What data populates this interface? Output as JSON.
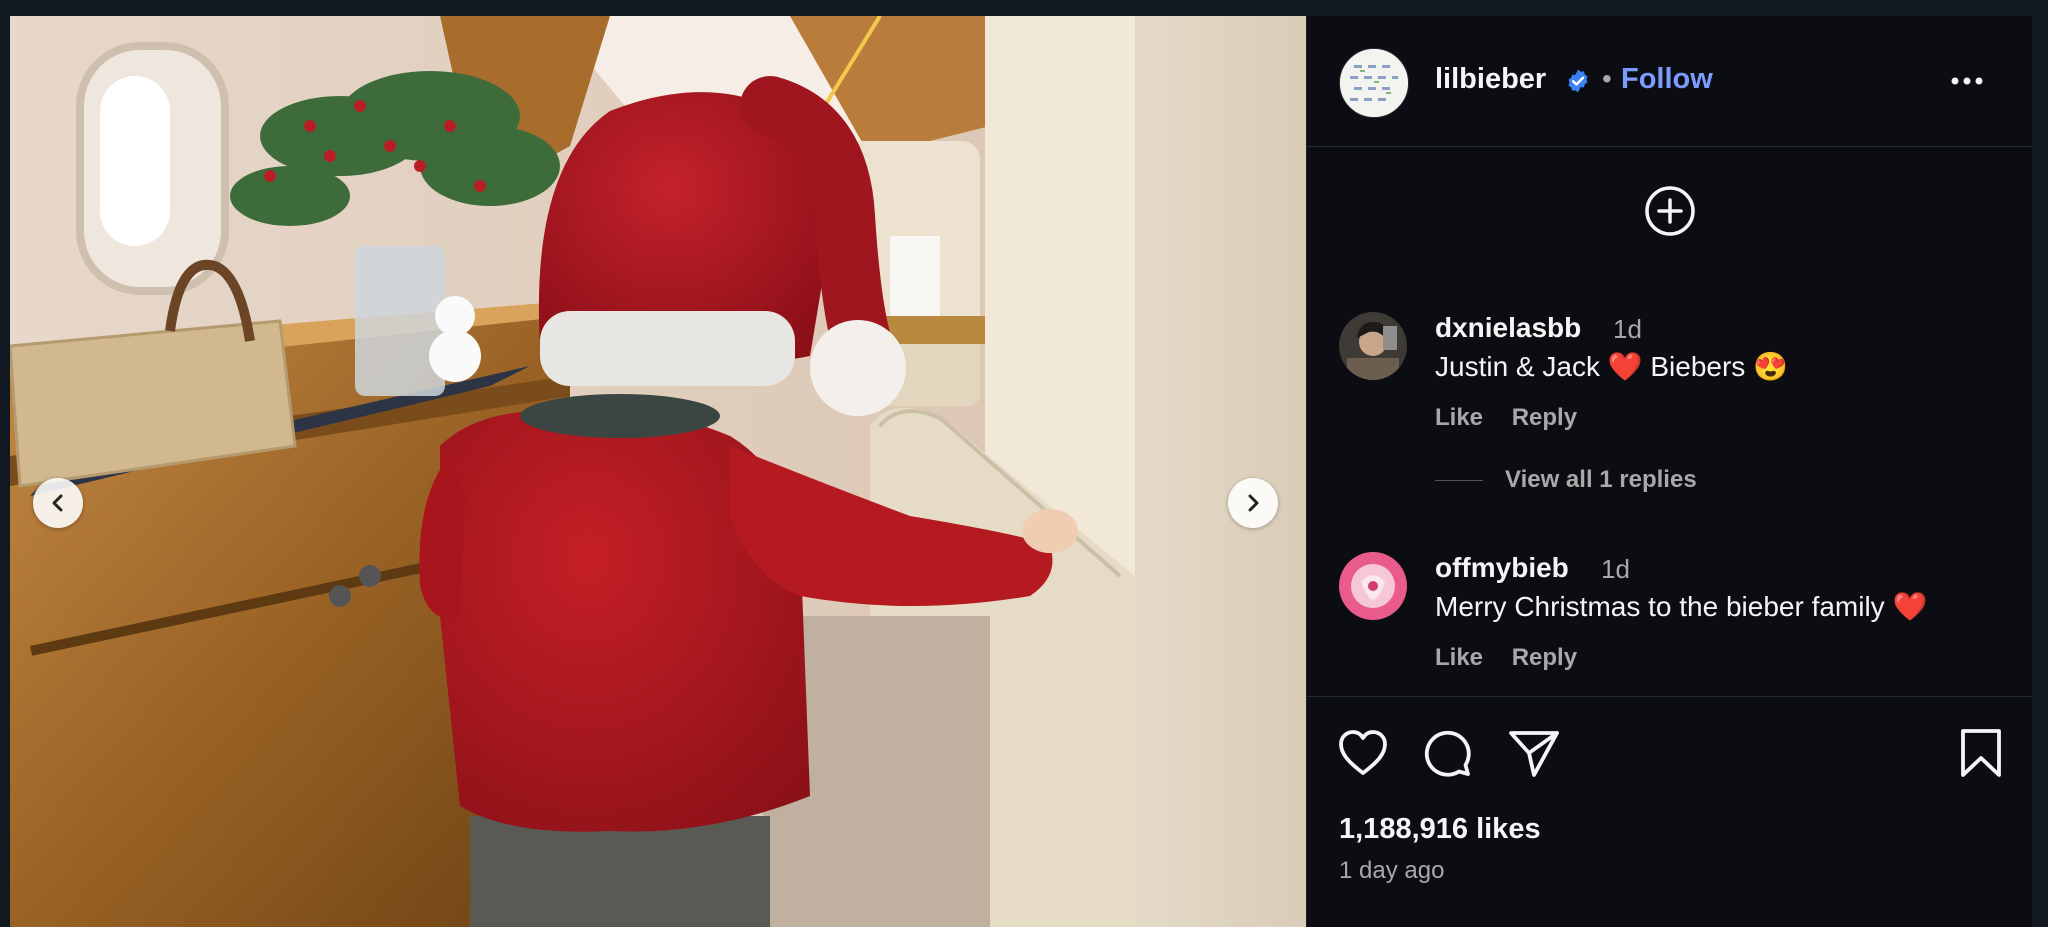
{
  "post": {
    "author": "lilbieber",
    "follow_label": "Follow",
    "separator": "•",
    "likes": "1,188,916 likes",
    "posted": "1 day ago"
  },
  "comments": [
    {
      "user": "dxnielasbb",
      "time": "1d",
      "text": "Justin & Jack ❤️ Biebers 😍",
      "like_label": "Like",
      "reply_label": "Reply",
      "view_replies": "View all 1 replies"
    },
    {
      "user": "offmybieb",
      "time": "1d",
      "text": "Merry Christmas to the bieber family ❤️",
      "like_label": "Like",
      "reply_label": "Reply"
    }
  ],
  "icons": {
    "verified": "verified-badge-icon",
    "more": "more-options-icon",
    "add": "add-comment-icon",
    "like": "heart-icon",
    "comment": "comment-icon",
    "share": "share-icon",
    "save": "bookmark-icon",
    "prev": "chevron-left-icon",
    "next": "chevron-right-icon"
  },
  "colors": {
    "background": "#0b0d12",
    "link": "#7b9cff",
    "verified": "#3b82f6",
    "muted": "#a8a8a8"
  }
}
